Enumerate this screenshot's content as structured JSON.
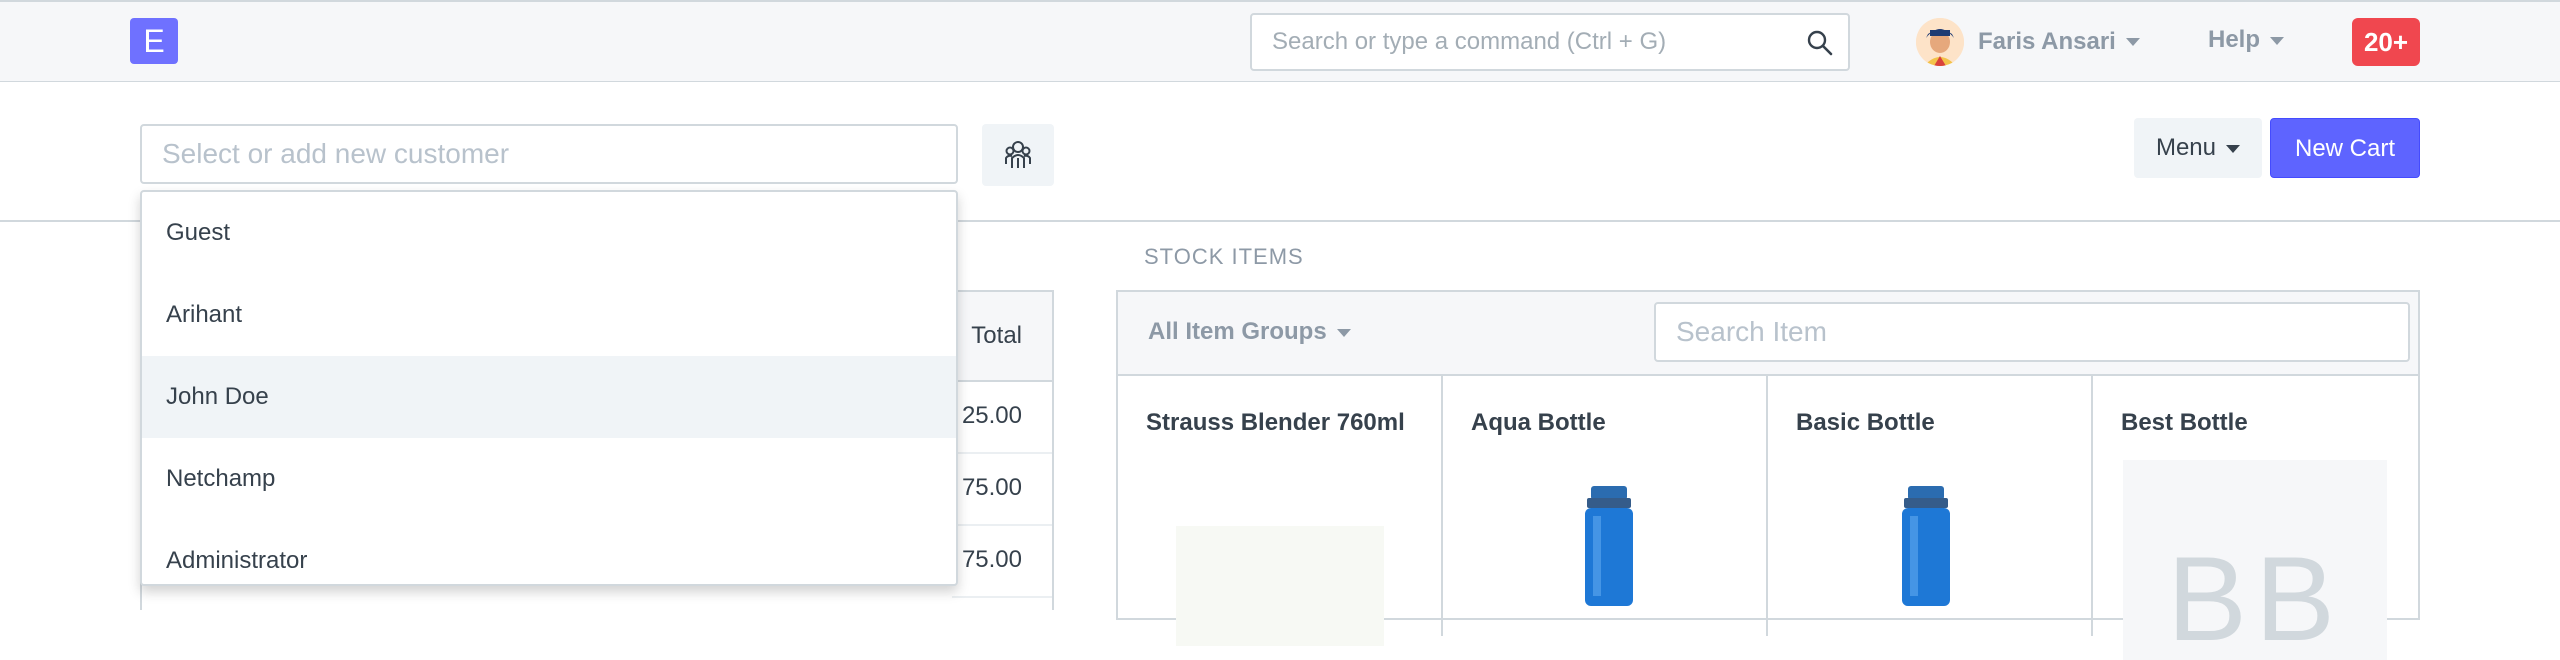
{
  "navbar": {
    "logo_letter": "E",
    "search_placeholder": "Search or type a command (Ctrl + G)",
    "user_name": "Faris Ansari",
    "help_label": "Help",
    "notifications_count": "20+"
  },
  "pos": {
    "customer_placeholder": "Select or add new customer",
    "menu_label": "Menu",
    "new_cart_label": "New Cart",
    "customer_options": [
      "Guest",
      "Arihant",
      "John Doe",
      "Netchamp",
      "Administrator"
    ],
    "highlighted_option": "John Doe",
    "cart": {
      "total_header": "Total",
      "row_totals": [
        "25.00",
        "75.00",
        "75.00"
      ]
    }
  },
  "stock": {
    "section_label": "STOCK ITEMS",
    "item_groups_label": "All Item Groups",
    "search_placeholder": "Search Item",
    "items": [
      {
        "name": "Strauss Blender 760ml"
      },
      {
        "name": "Aqua Bottle"
      },
      {
        "name": "Basic Bottle"
      },
      {
        "name": "Best Bottle",
        "placeholder_initials": "BB"
      }
    ]
  },
  "colors": {
    "primary": "#5e64ff",
    "logo": "#6f71ff",
    "notification": "#f0474f"
  }
}
